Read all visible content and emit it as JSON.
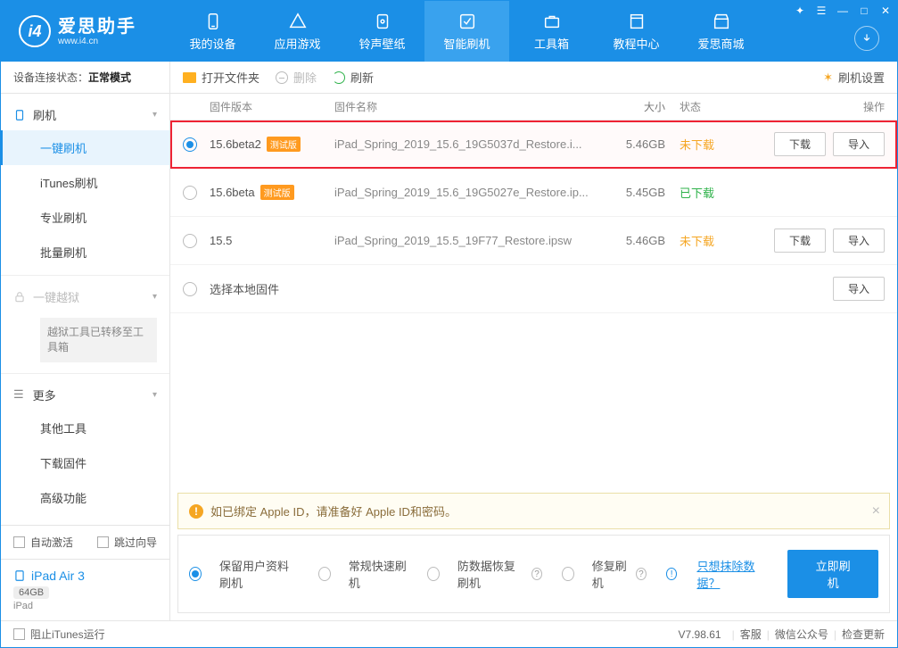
{
  "app": {
    "title": "爱思助手",
    "subtitle": "www.i4.cn"
  },
  "wincontrols": [
    "✦",
    "☰",
    "—",
    "□",
    "✕"
  ],
  "nav": [
    {
      "label": "我的设备",
      "icon": "device"
    },
    {
      "label": "应用游戏",
      "icon": "apps"
    },
    {
      "label": "铃声壁纸",
      "icon": "music"
    },
    {
      "label": "智能刷机",
      "icon": "flash",
      "active": true
    },
    {
      "label": "工具箱",
      "icon": "toolbox"
    },
    {
      "label": "教程中心",
      "icon": "book"
    },
    {
      "label": "爱思商城",
      "icon": "store"
    }
  ],
  "status": {
    "label": "设备连接状态：",
    "value": "正常模式"
  },
  "sidebar": {
    "flash": {
      "head": "刷机",
      "items": [
        "一键刷机",
        "iTunes刷机",
        "专业刷机",
        "批量刷机"
      ],
      "activeIndex": 0
    },
    "jailbreak": {
      "head": "一键越狱",
      "note": "越狱工具已转移至工具箱"
    },
    "more": {
      "head": "更多",
      "items": [
        "其他工具",
        "下载固件",
        "高级功能"
      ]
    },
    "autoActivate": "自动激活",
    "skipGuide": "跳过向导"
  },
  "device": {
    "name": "iPad Air 3",
    "storage": "64GB",
    "type": "iPad"
  },
  "toolbar": {
    "open": "打开文件夹",
    "delete": "删除",
    "refresh": "刷新",
    "settings": "刷机设置"
  },
  "columns": {
    "ver": "固件版本",
    "name": "固件名称",
    "size": "大小",
    "status": "状态",
    "op": "操作"
  },
  "rows": [
    {
      "sel": true,
      "hl": true,
      "ver": "15.6beta2",
      "beta": "测试版",
      "name": "iPad_Spring_2019_15.6_19G5037d_Restore.i...",
      "size": "5.46GB",
      "status": "未下载",
      "statusCls": "st-nd",
      "ops": [
        "下载",
        "导入"
      ]
    },
    {
      "sel": false,
      "ver": "15.6beta",
      "beta": "测试版",
      "name": "iPad_Spring_2019_15.6_19G5027e_Restore.ip...",
      "size": "5.45GB",
      "status": "已下载",
      "statusCls": "st-dd",
      "ops": []
    },
    {
      "sel": false,
      "ver": "15.5",
      "name": "iPad_Spring_2019_15.5_19F77_Restore.ipsw",
      "size": "5.46GB",
      "status": "未下载",
      "statusCls": "st-nd",
      "ops": [
        "下载",
        "导入"
      ]
    },
    {
      "sel": false,
      "ver": "",
      "localLabel": "选择本地固件",
      "ops": [
        "导入"
      ]
    }
  ],
  "notice": "如已绑定 Apple ID，请准备好 Apple ID和密码。",
  "options": {
    "items": [
      "保留用户资料刷机",
      "常规快速刷机",
      "防数据恢复刷机",
      "修复刷机"
    ],
    "selected": 0,
    "eraseLink": "只想抹除数据？",
    "primary": "立即刷机"
  },
  "footer": {
    "blockItunes": "阻止iTunes运行",
    "version": "V7.98.61",
    "links": [
      "客服",
      "微信公众号",
      "检查更新"
    ]
  }
}
